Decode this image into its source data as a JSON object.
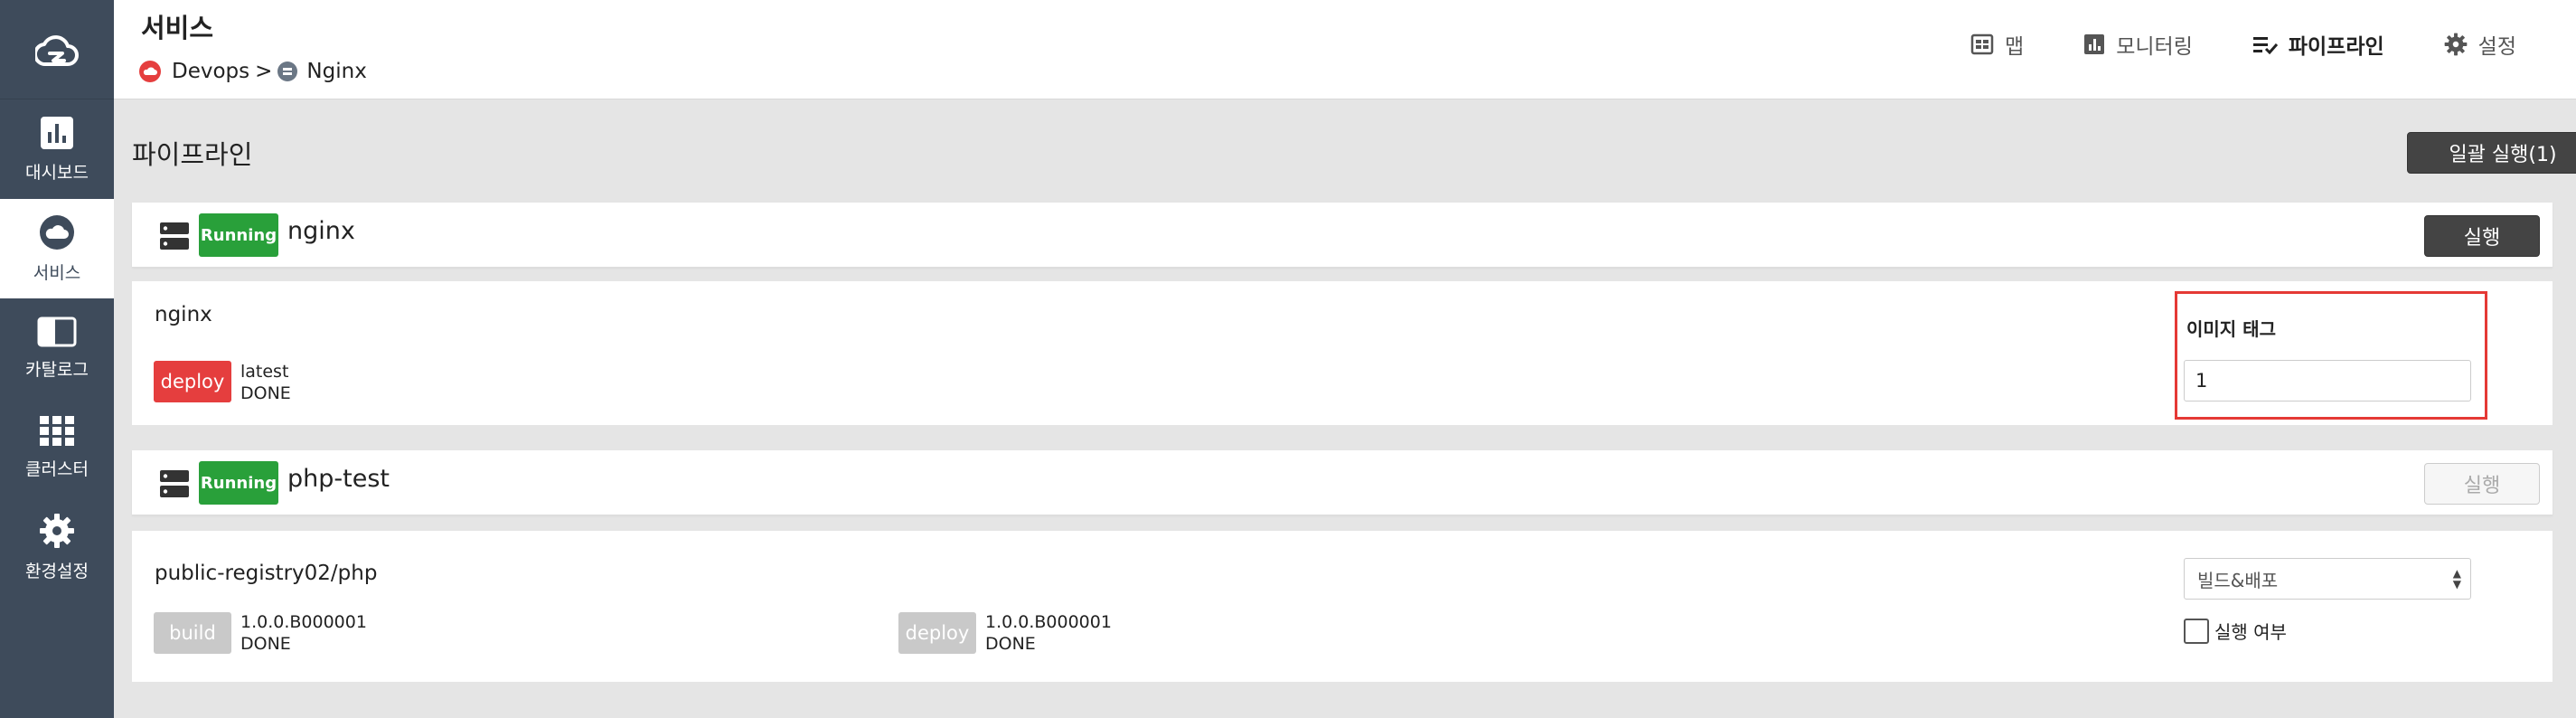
{
  "sidebar": {
    "logo_icon": "cloud-logo-icon",
    "items": [
      {
        "label": "대시보드",
        "icon": "bar-chart-icon"
      },
      {
        "label": "서비스",
        "icon": "cloud-icon",
        "active": true
      },
      {
        "label": "카탈로그",
        "icon": "book-icon"
      },
      {
        "label": "클러스터",
        "icon": "grid-icon"
      },
      {
        "label": "환경설정",
        "icon": "gear-icon"
      }
    ]
  },
  "header": {
    "title": "서비스",
    "breadcrumb": {
      "parent": "Devops",
      "separator": ">",
      "current": "Nginx"
    },
    "nav": [
      {
        "label": "맵",
        "icon": "map-icon"
      },
      {
        "label": "모니터링",
        "icon": "monitoring-icon"
      },
      {
        "label": "파이프라인",
        "icon": "pipeline-icon",
        "active": true
      },
      {
        "label": "설정",
        "icon": "gear-icon"
      }
    ]
  },
  "main": {
    "section_title": "파이프라인",
    "run_all_label": "일괄 실행(1)",
    "pipelines": [
      {
        "status": "Running",
        "name": "nginx",
        "run_label": "실행",
        "repo": "nginx",
        "stages": [
          {
            "type": "deploy",
            "tag": "latest",
            "state": "DONE"
          }
        ],
        "image_tag_label": "이미지 태그",
        "image_tag_value": "1"
      },
      {
        "status": "Running",
        "name": "php-test",
        "run_label": "실행",
        "run_disabled": true,
        "repo": "public-registry02/php",
        "stages": [
          {
            "type": "build",
            "tag": "1.0.0.B000001",
            "state": "DONE"
          },
          {
            "type": "deploy",
            "tag": "1.0.0.B000001",
            "state": "DONE"
          }
        ],
        "select_value": "빌드&배포",
        "checkbox_label": "실행 여부"
      }
    ]
  },
  "colors": {
    "sidebar_bg": "#3e4b5b",
    "running_green": "#29a03a",
    "deploy_red": "#e53e3e",
    "highlight_red": "#e53935"
  }
}
